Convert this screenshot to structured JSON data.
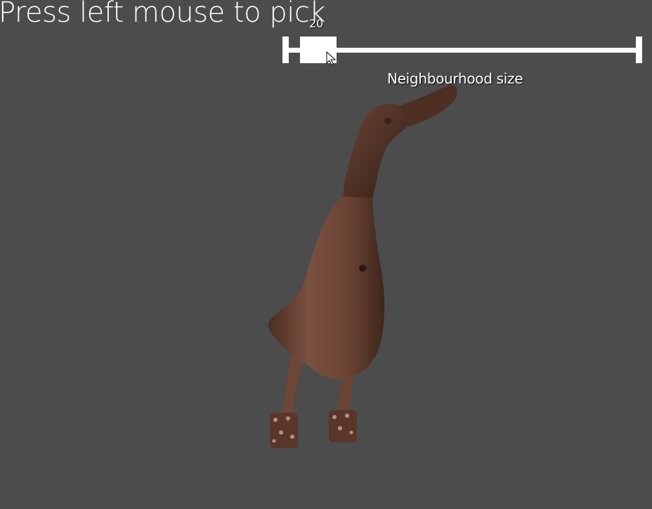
{
  "scene": {
    "instruction": "Press left mouse to pick",
    "background_color": "#4c4c4c"
  },
  "slider": {
    "title": "Neighbourhood size",
    "value": "20",
    "fraction": 0.05,
    "color": "#ffffff"
  },
  "model": {
    "icon": "duck-model",
    "color": "#6b4535"
  },
  "cursor": {
    "icon": "mouse-pointer-icon"
  }
}
